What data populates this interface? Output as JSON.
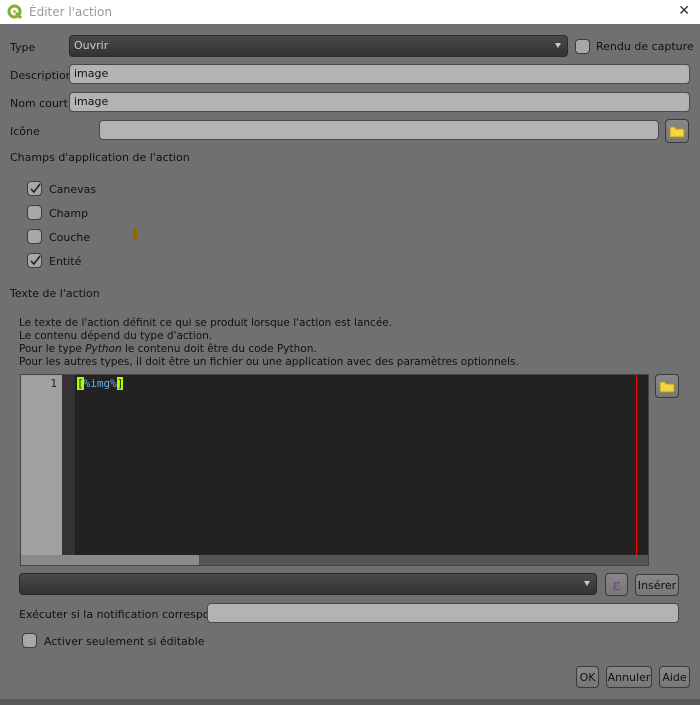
{
  "window": {
    "title": "Éditer l'action",
    "close_icon": "close-icon"
  },
  "form": {
    "type_label": "Type",
    "type_value": "Ouvrir",
    "capture_label": "Rendu de capture",
    "capture_checked": false,
    "description_label": "Description",
    "description_value": "image",
    "short_name_label": "Nom court",
    "short_name_value": "image",
    "icon_label": "Icône",
    "icon_value": ""
  },
  "scopes": {
    "title": "Champs d'application de l'action",
    "items": [
      {
        "label": "Canevas",
        "checked": true
      },
      {
        "label": "Champ",
        "checked": false
      },
      {
        "label": "Couche",
        "checked": false
      },
      {
        "label": "Entité",
        "checked": true
      }
    ]
  },
  "action_text": {
    "title": "Texte de l'action",
    "help": {
      "line1": "Le texte de l'action définit ce qui se produit lorsque l'action est lancée.",
      "line2": "Le contenu dépend du type d'action.",
      "line3_pre": "Pour le type ",
      "line3_em": "Python",
      "line3_post": " le contenu doit être du code Python.",
      "line4": "Pour les autres types, il doit être un fichier ou une application avec des paramètres optionnels."
    },
    "editor": {
      "line_number": "1",
      "bracket_open": "[",
      "expr": "%img%",
      "bracket_close": "]"
    }
  },
  "insert": {
    "combo_value": "",
    "expression_button": "ε",
    "insert_button": "Insérer"
  },
  "notification": {
    "label": "Exécuter si la notification correspond.",
    "value": ""
  },
  "editable_only": {
    "label": "Activer seulement si éditable",
    "checked": false
  },
  "buttons": {
    "ok": "OK",
    "cancel": "Annuler",
    "help": "Aide"
  },
  "colors": {
    "highlight": "#aaff00",
    "folder": "#f5d442",
    "margin_line": "#ff0000"
  }
}
